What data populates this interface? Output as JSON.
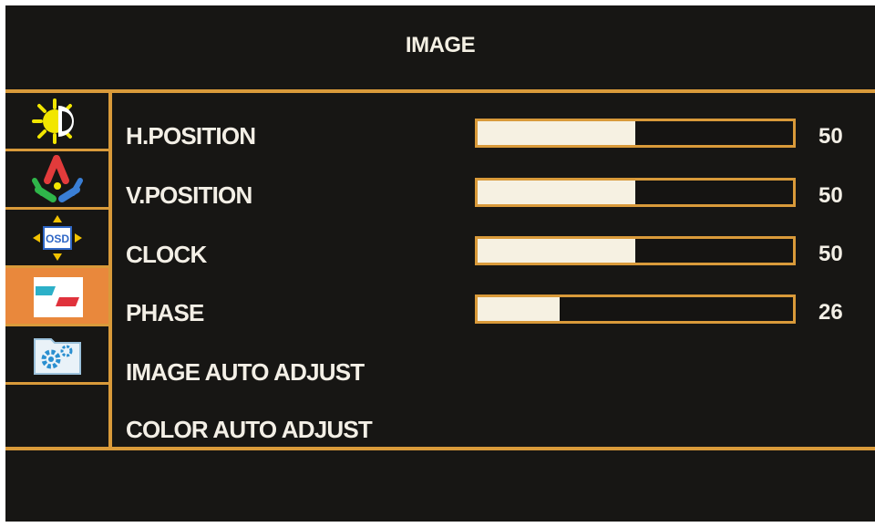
{
  "title": "IMAGE",
  "tabs": [
    {
      "icon": "brightness-contrast-icon",
      "active": false
    },
    {
      "icon": "color-icon",
      "active": false
    },
    {
      "icon": "osd-icon",
      "label": "OSD",
      "active": false
    },
    {
      "icon": "image-geometry-icon",
      "active": true
    },
    {
      "icon": "settings-gears-icon",
      "active": false
    }
  ],
  "items": [
    {
      "label": "H.POSITION",
      "value": 50,
      "value_text": "50"
    },
    {
      "label": "V.POSITION",
      "value": 50,
      "value_text": "50"
    },
    {
      "label": "CLOCK",
      "value": 50,
      "value_text": "50"
    },
    {
      "label": "PHASE",
      "value": 26,
      "value_text": "26"
    },
    {
      "label": "IMAGE AUTO ADJUST"
    },
    {
      "label": "COLOR AUTO ADJUST"
    }
  ],
  "colors": {
    "background": "#171614",
    "accent": "#d99a3a",
    "active_tab": "#e9883c",
    "text": "#f3efe6",
    "bar_fill": "#f6f1e2"
  }
}
